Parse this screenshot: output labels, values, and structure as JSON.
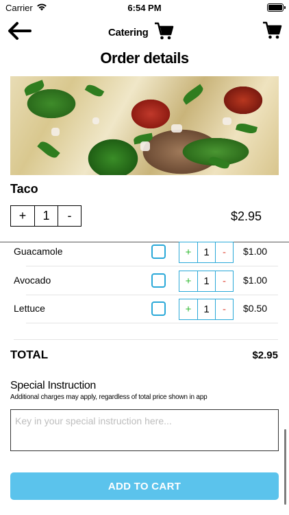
{
  "status_bar": {
    "carrier": "Carrier",
    "time": "6:54 PM"
  },
  "nav": {
    "title": "Catering",
    "back_icon": "arrow-left-icon",
    "cart_icon": "shopping-cart-icon"
  },
  "page": {
    "heading": "Order details"
  },
  "product": {
    "name": "Taco",
    "quantity": "1",
    "plus": "+",
    "minus": "-",
    "price": "$2.95"
  },
  "addons": [
    {
      "label": "Guacamole",
      "checked": false,
      "plus": "+",
      "quantity": "1",
      "minus": "-",
      "price": "$1.00"
    },
    {
      "label": "Avocado",
      "checked": false,
      "plus": "+",
      "quantity": "1",
      "minus": "-",
      "price": "$1.00"
    },
    {
      "label": "Lettuce",
      "checked": false,
      "plus": "+",
      "quantity": "1",
      "minus": "-",
      "price": "$0.50"
    }
  ],
  "total": {
    "label": "TOTAL",
    "value": "$2.95"
  },
  "special": {
    "title": "Special Instruction",
    "note": "Additional charges may apply, regardless of total price shown in app",
    "placeholder": "Key in your special instruction here...",
    "value": ""
  },
  "actions": {
    "add_to_cart": "ADD TO CART"
  },
  "colors": {
    "accent": "#5bc3ec",
    "border_blue": "#29a8d8",
    "plus_green": "#2eb82e",
    "minus_red": "#e0483a"
  }
}
